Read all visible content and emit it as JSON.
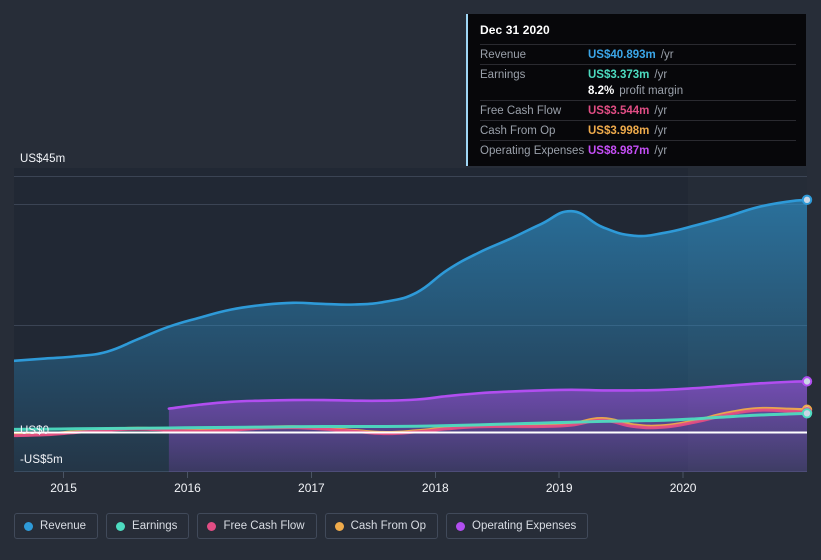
{
  "colors": {
    "page_background": "#272d38",
    "plot_background": "#232a36",
    "plot_background_band": "#202634",
    "revenue": "#2e9ad8",
    "earnings": "#4ddbc0",
    "free_cash_flow": "#e14d84",
    "cash_from_op": "#efab4b",
    "operating_expenses": "#b14ef0",
    "zero_line": "#ffffff",
    "gridline": "#3b4454",
    "tooltip_background": "#07070a",
    "tooltip_accent": "#9fd6f5"
  },
  "tooltip": {
    "date": "Dec 31 2020",
    "rows": [
      {
        "key": "Revenue",
        "value": "US$40.893m",
        "unit": "/yr",
        "color": "#3ba6e8"
      },
      {
        "key": "Earnings",
        "value": "US$3.373m",
        "unit": "/yr",
        "color": "#4ddbc0"
      },
      {
        "key": "",
        "value": "8.2%",
        "unit": "profit margin",
        "color": "#ffffff",
        "is_margin": true
      },
      {
        "key": "Free Cash Flow",
        "value": "US$3.544m",
        "unit": "/yr",
        "color": "#e14d84"
      },
      {
        "key": "Cash From Op",
        "value": "US$3.998m",
        "unit": "/yr",
        "color": "#efab4b"
      },
      {
        "key": "Operating Expenses",
        "value": "US$8.987m",
        "unit": "/yr",
        "color": "#c44ef5"
      }
    ]
  },
  "axes": {
    "y_labels": [
      {
        "text": "US$45m",
        "value": 45
      },
      {
        "text": "US$0",
        "value": 0
      },
      {
        "text": "-US$5m",
        "value": -5
      }
    ],
    "x_labels": [
      "2015",
      "2016",
      "2017",
      "2018",
      "2019",
      "2020"
    ]
  },
  "legend": [
    {
      "label": "Revenue",
      "color": "#2e9ad8"
    },
    {
      "label": "Earnings",
      "color": "#4ddbc0"
    },
    {
      "label": "Free Cash Flow",
      "color": "#e14d84"
    },
    {
      "label": "Cash From Op",
      "color": "#efab4b"
    },
    {
      "label": "Operating Expenses",
      "color": "#b14ef0"
    }
  ],
  "chart_data": {
    "type": "area",
    "title": "",
    "xlabel": "",
    "ylabel": "US$m per year",
    "ylim": [
      -5,
      45
    ],
    "y_ticks": [
      45,
      0,
      -5
    ],
    "grid": true,
    "legend_position": "bottom",
    "currency": "USD",
    "units": "millions per year",
    "x_tick_years": [
      2015,
      2016,
      2017,
      2018,
      2019,
      2020
    ],
    "x_range": [
      "2014-07",
      "2021-01"
    ],
    "highlight_band": {
      "from": 2020.0,
      "to": 2021.0
    },
    "end_markers": [
      "Revenue",
      "Operating Expenses",
      "Free Cash Flow",
      "Cash From Op",
      "Earnings"
    ],
    "x": [
      2014.6,
      2014.85,
      2015.1,
      2015.35,
      2015.6,
      2015.85,
      2016.1,
      2016.35,
      2016.6,
      2016.85,
      2017.1,
      2017.35,
      2017.6,
      2017.85,
      2018.1,
      2018.35,
      2018.6,
      2018.85,
      2019.1,
      2019.35,
      2019.6,
      2019.85,
      2020.1,
      2020.35,
      2020.6,
      2020.85,
      2021.0
    ],
    "series": [
      {
        "name": "Revenue",
        "color": "#2e9ad8",
        "filled": true,
        "values": [
          12.6,
          13.0,
          13.4,
          14.2,
          16.4,
          18.6,
          20.2,
          21.6,
          22.4,
          22.8,
          22.6,
          22.5,
          23.0,
          24.6,
          28.6,
          31.6,
          34.0,
          36.6,
          38.9,
          36.1,
          34.6,
          35.1,
          36.4,
          37.9,
          39.6,
          40.6,
          40.893
        ]
      },
      {
        "name": "Operating Expenses",
        "color": "#b14ef0",
        "filled": true,
        "start_x": 2015.85,
        "values": [
          null,
          null,
          null,
          null,
          null,
          4.2,
          4.9,
          5.4,
          5.6,
          5.7,
          5.7,
          5.6,
          5.6,
          5.8,
          6.4,
          6.9,
          7.2,
          7.4,
          7.5,
          7.4,
          7.4,
          7.5,
          7.8,
          8.2,
          8.6,
          8.9,
          8.987
        ]
      },
      {
        "name": "Cash From Op",
        "color": "#efab4b",
        "filled": false,
        "values": [
          -0.4,
          -0.25,
          0.15,
          0.55,
          0.75,
          0.55,
          0.35,
          0.55,
          0.9,
          1.0,
          0.75,
          0.35,
          0.0,
          0.3,
          0.85,
          1.2,
          1.25,
          1.25,
          1.55,
          2.45,
          1.35,
          1.2,
          2.1,
          3.4,
          4.2,
          4.1,
          3.998
        ]
      },
      {
        "name": "Free Cash Flow",
        "color": "#e14d84",
        "filled": false,
        "values": [
          -0.55,
          -0.4,
          0.0,
          0.4,
          0.6,
          0.4,
          0.2,
          0.4,
          0.75,
          0.85,
          0.6,
          0.2,
          -0.2,
          0.1,
          0.65,
          1.0,
          1.05,
          1.05,
          1.3,
          2.15,
          1.05,
          0.95,
          1.85,
          3.1,
          3.9,
          3.75,
          3.544
        ]
      },
      {
        "name": "Earnings",
        "color": "#4ddbc0",
        "filled": false,
        "values": [
          0.55,
          0.6,
          0.65,
          0.7,
          0.75,
          0.8,
          0.85,
          0.9,
          0.95,
          1.0,
          1.05,
          1.05,
          1.05,
          1.1,
          1.2,
          1.35,
          1.5,
          1.65,
          1.8,
          1.95,
          2.05,
          2.15,
          2.4,
          2.75,
          3.05,
          3.25,
          3.373
        ]
      }
    ]
  }
}
